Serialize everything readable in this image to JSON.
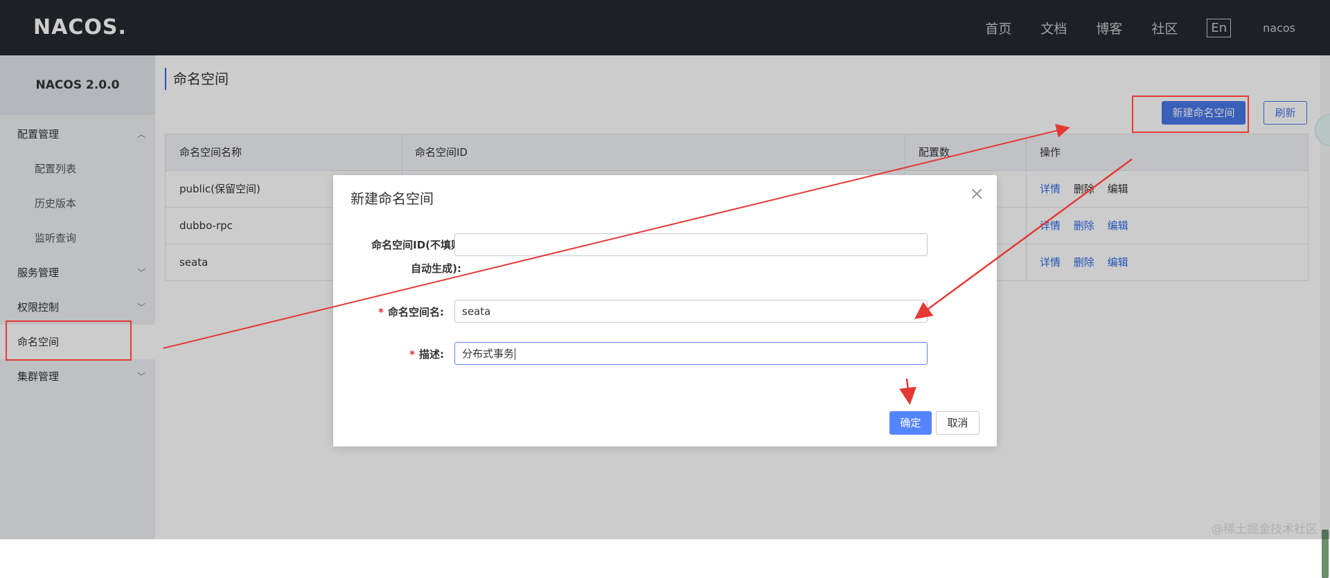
{
  "header": {
    "logo_text": "NACOS.",
    "nav": [
      "首页",
      "文档",
      "博客",
      "社区"
    ],
    "lang": "En",
    "user": "nacos"
  },
  "sidebar": {
    "title": "NACOS 2.0.0",
    "items": [
      {
        "label": "配置管理",
        "type": "group",
        "chevron": "up"
      },
      {
        "label": "配置列表",
        "type": "sub"
      },
      {
        "label": "历史版本",
        "type": "sub"
      },
      {
        "label": "监听查询",
        "type": "sub"
      },
      {
        "label": "服务管理",
        "type": "group",
        "chevron": "down"
      },
      {
        "label": "权限控制",
        "type": "group",
        "chevron": "down"
      },
      {
        "label": "命名空间",
        "type": "item",
        "active": true
      },
      {
        "label": "集群管理",
        "type": "group",
        "chevron": "down"
      }
    ]
  },
  "main": {
    "title": "命名空间",
    "new_button": "新建命名空间",
    "refresh_button": "刷新",
    "table": {
      "columns": [
        "命名空间名称",
        "命名空间ID",
        "配置数",
        "操作"
      ],
      "rows": [
        {
          "name": "public(保留空间)",
          "ops": [
            "详情",
            "删除",
            "编辑"
          ]
        },
        {
          "name": "dubbo-rpc",
          "ops": [
            "详情",
            "删除",
            "编辑"
          ]
        },
        {
          "name": "seata",
          "ops": [
            "详情",
            "删除",
            "编辑"
          ]
        }
      ]
    }
  },
  "dialog": {
    "title": "新建命名空间",
    "close_icon": "×",
    "fields": {
      "id_label_line1": "命名空间ID(不填则",
      "id_label_line2": "自动生成):",
      "id_value": "",
      "name_label": "命名空间名:",
      "name_value": "seata",
      "desc_label": "描述:",
      "desc_value": "分布式事务",
      "required_mark": "*"
    },
    "ok": "确定",
    "cancel": "取消"
  },
  "watermark": "@稀土掘金技术社区",
  "colors": {
    "primary": "#4977e8",
    "annotation": "#e53935"
  }
}
